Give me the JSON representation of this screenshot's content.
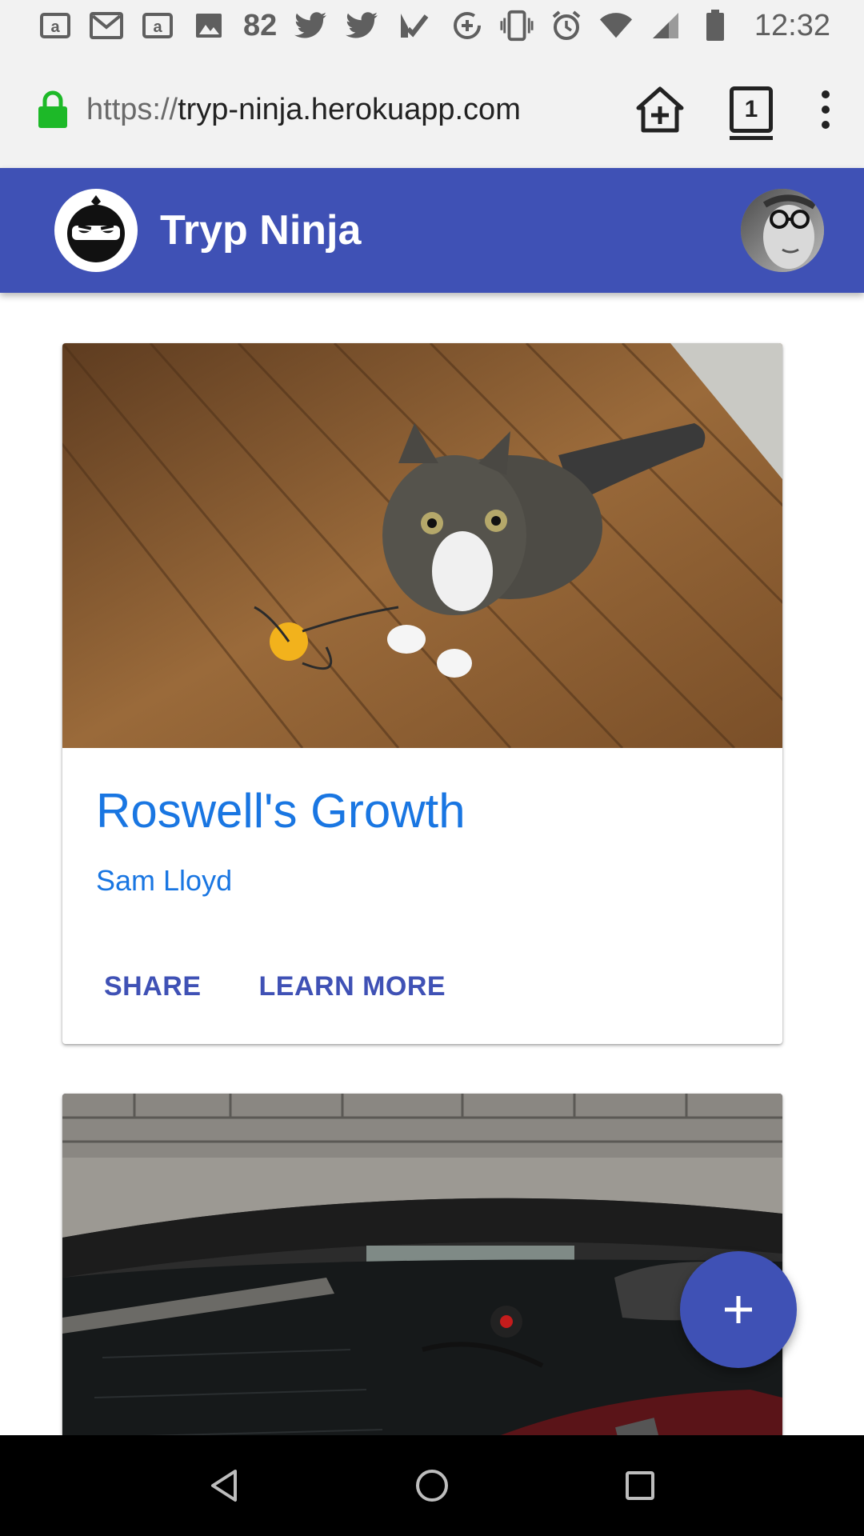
{
  "status_bar": {
    "notification_count": "82",
    "time": "12:32",
    "left_icons": [
      "amazon-icon",
      "gmail-icon",
      "amazon-icon",
      "image-icon",
      "twitter-icon",
      "twitter-icon",
      "checklist-icon"
    ],
    "right_icons": [
      "data-saver-icon",
      "vibrate-icon",
      "alarm-icon",
      "wifi-icon",
      "signal-icon",
      "battery-icon"
    ]
  },
  "browser": {
    "url_scheme": "https://",
    "url_host": "tryp-ninja.herokuapp.com",
    "tab_count": "1",
    "lock_color": "#1db928"
  },
  "app": {
    "title": "Tryp Ninja",
    "accent_color": "#3f51b5"
  },
  "cards": [
    {
      "title": "Roswell's Growth",
      "subtitle": "Sam Lloyd",
      "actions": [
        "SHARE",
        "LEARN MORE"
      ],
      "image": "cat-on-wood-floor"
    },
    {
      "image": "boat-under-bridge"
    }
  ],
  "fab": {
    "icon": "plus-icon"
  },
  "nav_bar": {
    "icons": [
      "back-icon",
      "home-icon",
      "recents-icon"
    ]
  }
}
